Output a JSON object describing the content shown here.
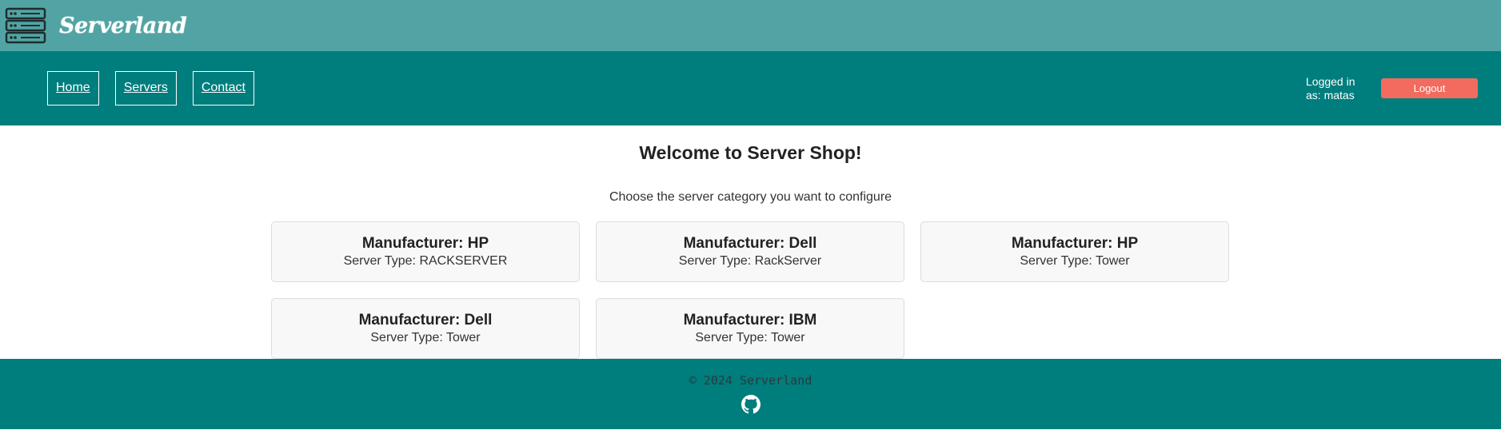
{
  "header": {
    "brand": "Serverland",
    "logo_icon": "server-rack-icon"
  },
  "nav": {
    "links": [
      {
        "label": "Home"
      },
      {
        "label": "Servers"
      },
      {
        "label": "Contact"
      }
    ],
    "logged_in_text": "Logged in as: matas",
    "logout_label": "Logout"
  },
  "main": {
    "title": "Welcome to Server Shop!",
    "subtitle": "Choose the server category you want to configure",
    "categories": [
      {
        "manufacturer": "Manufacturer: HP",
        "type": "Server Type: RACKSERVER"
      },
      {
        "manufacturer": "Manufacturer: Dell",
        "type": "Server Type: RackServer"
      },
      {
        "manufacturer": "Manufacturer: HP",
        "type": "Server Type: Tower"
      },
      {
        "manufacturer": "Manufacturer: Dell",
        "type": "Server Type: Tower"
      },
      {
        "manufacturer": "Manufacturer: IBM",
        "type": "Server Type: Tower"
      }
    ]
  },
  "footer": {
    "copyright": "© 2024 Serverland",
    "icon": "github-icon"
  },
  "colors": {
    "topbar": "#52a4a4",
    "navbar": "#007d7d",
    "logout": "#f26b5e",
    "card_bg": "#f8f8f8"
  }
}
